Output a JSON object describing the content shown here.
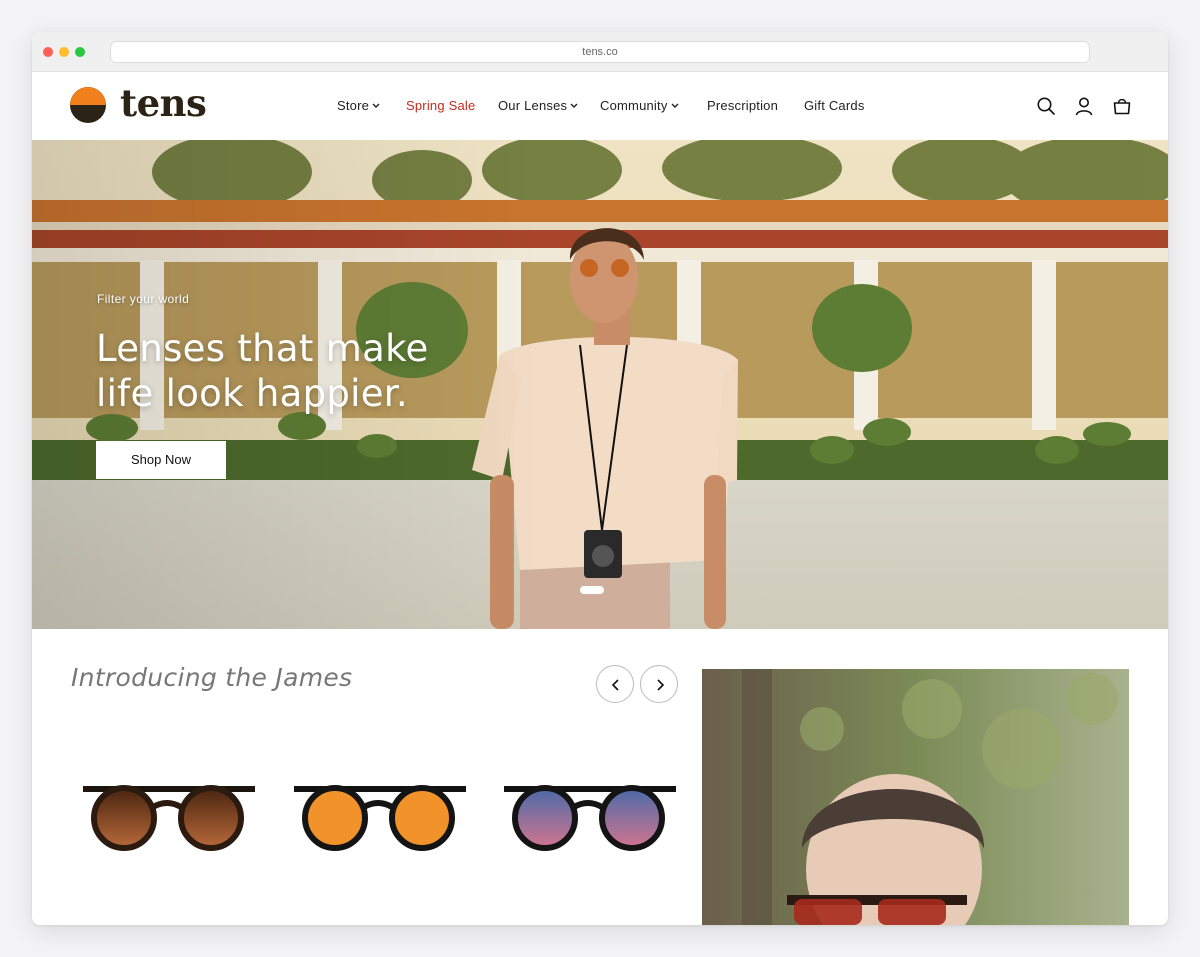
{
  "browser": {
    "url": "tens.co"
  },
  "brand": {
    "name": "tens",
    "accent": "#f07f1c",
    "dark": "#2b2416"
  },
  "nav": {
    "items": [
      {
        "label": "Store",
        "dropdown": true
      },
      {
        "label": "Spring Sale",
        "dropdown": false,
        "highlight": "#c8281e"
      },
      {
        "label": "Our Lenses",
        "dropdown": true
      },
      {
        "label": "Community",
        "dropdown": true
      },
      {
        "label": "Prescription",
        "dropdown": false
      },
      {
        "label": "Gift Cards",
        "dropdown": false
      }
    ],
    "icons": [
      "search-icon",
      "account-icon",
      "cart-icon"
    ]
  },
  "hero": {
    "eyebrow": "Filter your world",
    "title": "Lenses that make life look happier.",
    "cta": "Shop Now",
    "slides": 1,
    "active_slide": 1
  },
  "featured": {
    "title": "Introducing the James",
    "products": [
      {
        "lens_color": "brown-gradient"
      },
      {
        "lens_color": "orange"
      },
      {
        "lens_color": "blue-pink-gradient"
      }
    ]
  }
}
